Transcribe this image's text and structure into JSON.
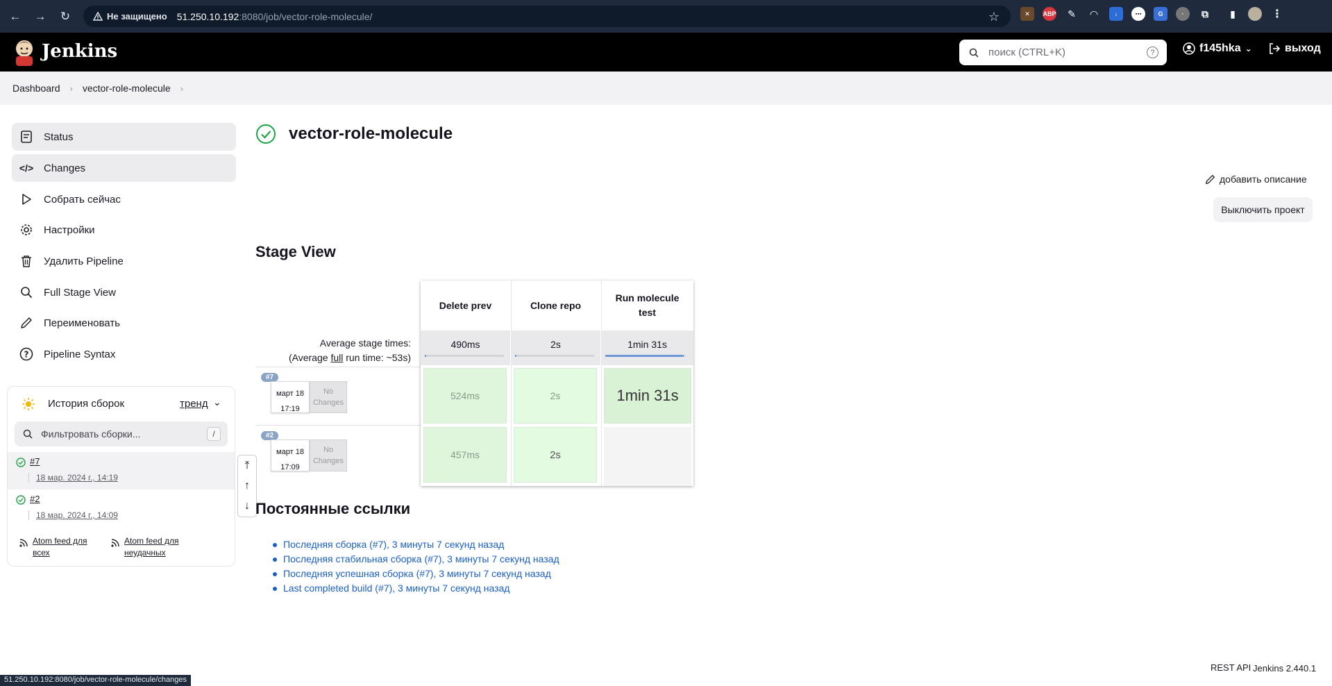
{
  "browser": {
    "insecure_label": "Не защищено",
    "url_host": "51.250.10.192",
    "url_path": ":8080/job/vector-role-molecule/",
    "status_url": "51.250.10.192:8080/job/vector-role-molecule/changes"
  },
  "header": {
    "brand": "Jenkins",
    "search_placeholder": "поиск (CTRL+K)",
    "user": "f145hka",
    "logout": "выход"
  },
  "breadcrumb": [
    "Dashboard",
    "vector-role-molecule"
  ],
  "sidebar": {
    "items": [
      {
        "label": "Status",
        "icon": "document-icon"
      },
      {
        "label": "Changes",
        "icon": "code-icon"
      },
      {
        "label": "Собрать сейчас",
        "icon": "play-icon"
      },
      {
        "label": "Настройки",
        "icon": "gear-icon"
      },
      {
        "label": "Удалить Pipeline",
        "icon": "trash-icon"
      },
      {
        "label": "Full Stage View",
        "icon": "magnifier-icon"
      },
      {
        "label": "Переименовать",
        "icon": "pencil-icon"
      },
      {
        "label": "Pipeline Syntax",
        "icon": "question-icon"
      }
    ]
  },
  "history": {
    "title": "История сборок",
    "trend": "тренд",
    "filter_placeholder": "Фильтровать сборки...",
    "filter_shortcut": "/",
    "builds": [
      {
        "number": "#7",
        "date": "18 мар. 2024 г., 14:19"
      },
      {
        "number": "#2",
        "date": "18 мар. 2024 г., 14:09"
      }
    ],
    "atom_all": "Atom feed для всех",
    "atom_failed": "Atom feed для неудачных"
  },
  "main": {
    "title": "vector-role-molecule",
    "add_description": "добавить описание",
    "disable_project": "Выключить проект",
    "stage_view_title": "Stage View",
    "avg_stage_label": "Average stage times:",
    "avg_full_prefix": "(Average ",
    "avg_full_word": "full",
    "avg_full_suffix": " run time: ~53s)",
    "stages": [
      {
        "name": "Delete prev",
        "avg": "490ms",
        "avg_fraction": 0.005
      },
      {
        "name": "Clone repo",
        "avg": "2s",
        "avg_fraction": 0.02
      },
      {
        "name": "Run molecule test",
        "avg": "1min 31s",
        "avg_fraction": 0.97
      }
    ],
    "runs": [
      {
        "badge": "#7",
        "date": "март 18",
        "time": "17:19",
        "changes": "No Changes",
        "durations": [
          "524ms",
          "2s",
          "1min 31s"
        ]
      },
      {
        "badge": "#2",
        "date": "март 18",
        "time": "17:09",
        "changes": "No Changes",
        "durations": [
          "457ms",
          "2s",
          ""
        ]
      }
    ],
    "permalinks_title": "Постоянные ссылки",
    "permalinks": [
      "Последняя сборка (#7), 3 минуты 7 секунд назад",
      "Последняя стабильная сборка (#7), 3 минуты 7 секунд назад",
      "Последняя успешная сборка (#7), 3 минуты 7 секунд назад",
      "Last completed build (#7), 3 минуты 7 секунд назад"
    ]
  },
  "footer": {
    "rest_api": "REST API",
    "version": "Jenkins 2.440.1"
  },
  "colors": {
    "success": "#1ea446",
    "link": "#1a5fc8",
    "stage_green": "#dff5dc"
  }
}
